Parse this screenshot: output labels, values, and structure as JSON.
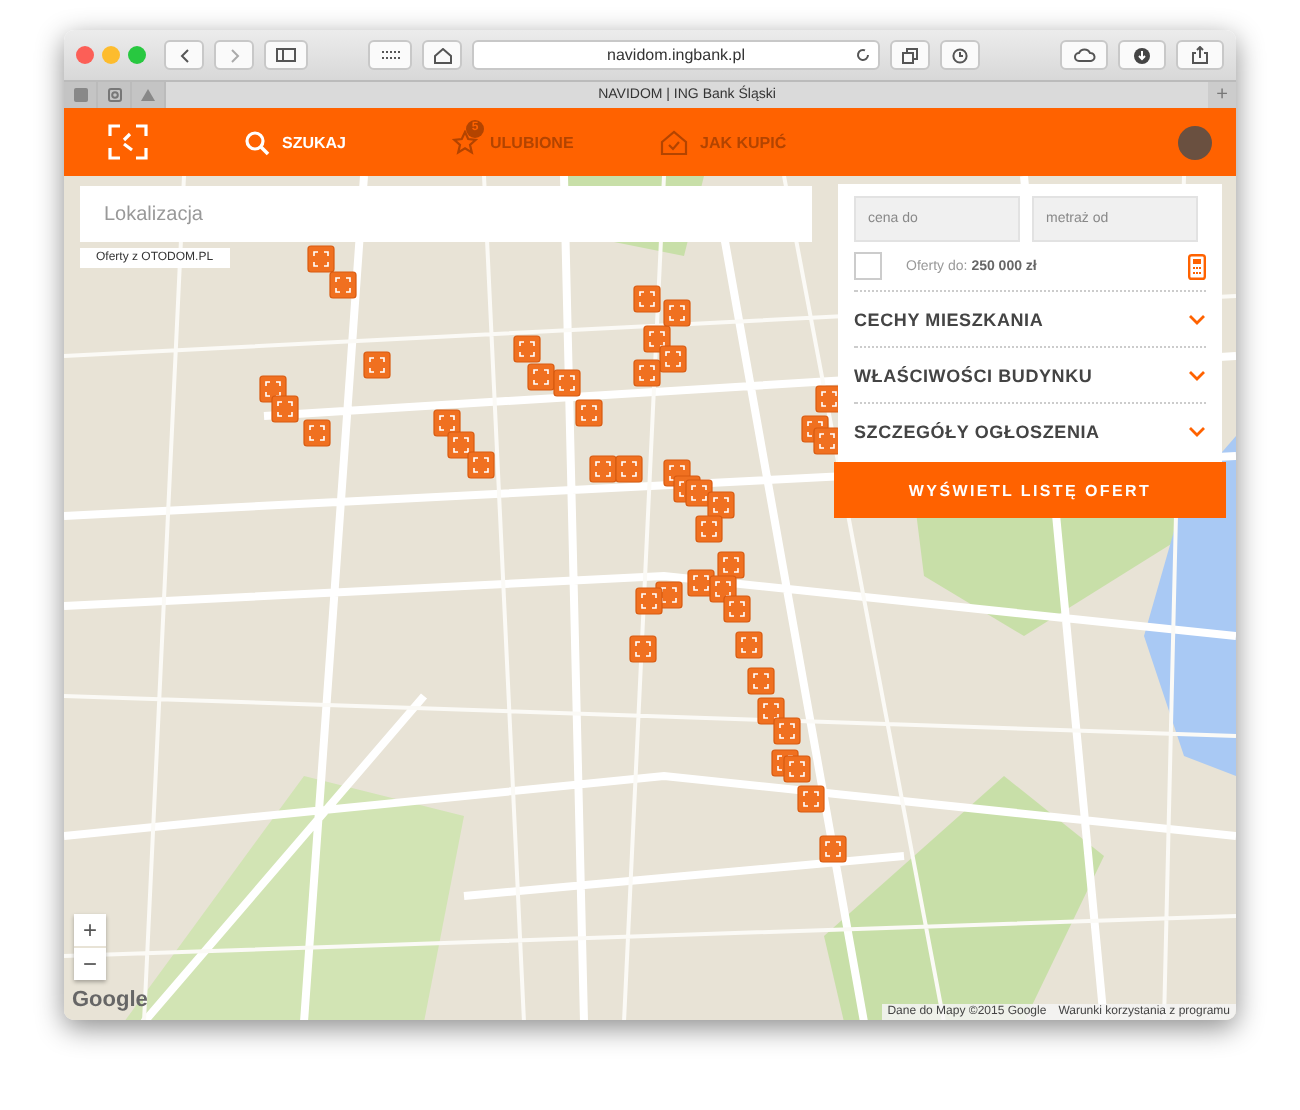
{
  "browser": {
    "url": "navidom.ingbank.pl",
    "tab_title": "NAVIDOM | ING Bank Śląski",
    "new_tab": "+"
  },
  "nav": {
    "items": [
      {
        "label": "SZUKAJ",
        "kind": "search",
        "selected": true
      },
      {
        "label": "ULUBIONE",
        "kind": "favorites",
        "badge": "5",
        "selected": false
      },
      {
        "label": "JAK KUPIĆ",
        "kind": "guide",
        "selected": false
      }
    ]
  },
  "search": {
    "placeholder": "Lokalizacja"
  },
  "source_note": "Oferty z OTODOM.PL",
  "filters": {
    "price_placeholder": "cena do",
    "area_placeholder": "metraż od",
    "limit": {
      "checked": false,
      "label": "Oferty do: **250 000 zł**"
    },
    "sections": [
      {
        "label": "CECHY MIESZKANIA",
        "expanded": false
      },
      {
        "label": "WŁAŚCIWOŚCI BUDYNKU",
        "expanded": false
      },
      {
        "label": "SZCZEGÓŁY OGŁOSZENIA",
        "expanded": false
      }
    ],
    "submit": "WYŚWIETL LISTĘ OFERT"
  },
  "map": {
    "zoom_in": "+",
    "zoom_out": "−",
    "logo": "Google",
    "attribution": "Dane do Mapy ©2015 Google",
    "terms": "Warunki korzystania z programu"
  }
}
